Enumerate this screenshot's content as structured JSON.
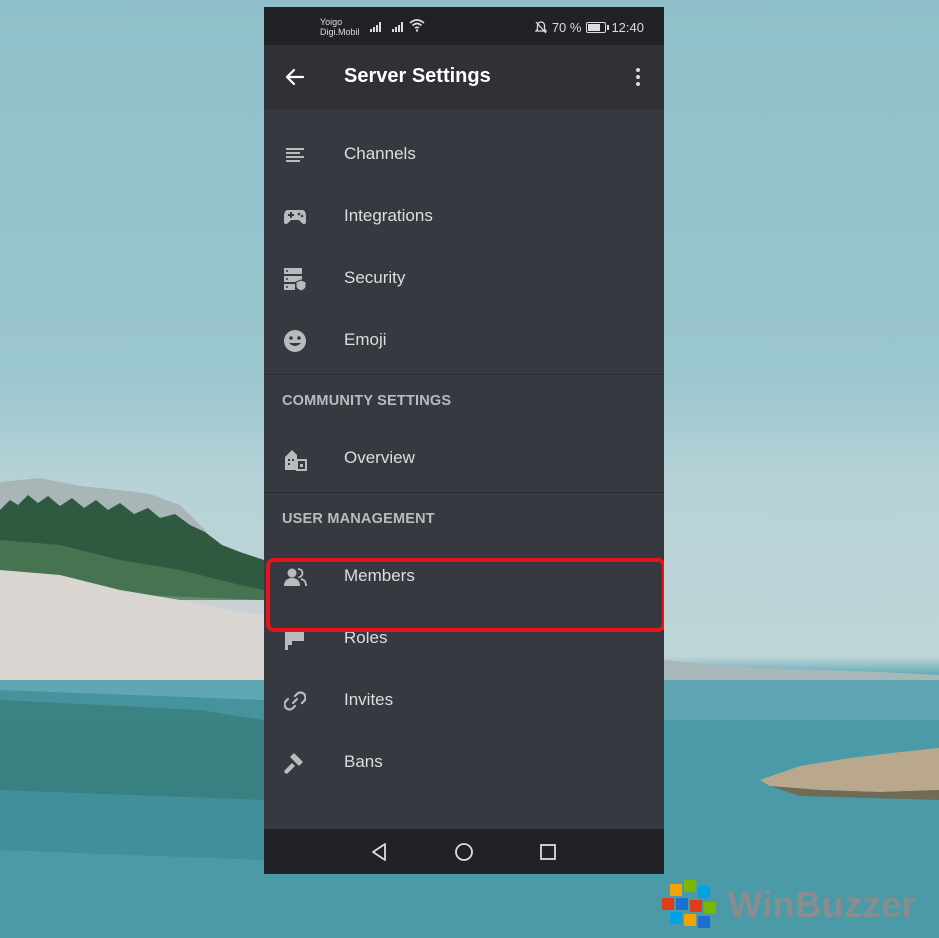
{
  "status_bar": {
    "carrier_1": "Yoigo",
    "carrier_2": "Digi.Mobil",
    "battery": "70 %",
    "battery_level": 0.7,
    "time": "12:40"
  },
  "app_bar": {
    "title": "Server Settings",
    "back_icon": "arrow-left-icon",
    "more_icon": "more-vertical-icon"
  },
  "menu": {
    "main_items": [
      {
        "label": "Channels",
        "icon": "list-icon"
      },
      {
        "label": "Integrations",
        "icon": "gamepad-icon"
      },
      {
        "label": "Security",
        "icon": "server-shield-icon"
      },
      {
        "label": "Emoji",
        "icon": "smile-icon"
      }
    ],
    "community_header": "COMMUNITY SETTINGS",
    "community_items": [
      {
        "label": "Overview",
        "icon": "community-icon"
      }
    ],
    "user_header": "USER MANAGEMENT",
    "user_items": [
      {
        "label": "Members",
        "icon": "people-icon"
      },
      {
        "label": "Roles",
        "icon": "flag-icon"
      },
      {
        "label": "Invites",
        "icon": "link-icon"
      },
      {
        "label": "Bans",
        "icon": "hammer-icon"
      }
    ]
  },
  "nav_bar": {
    "back": "triangle-back-icon",
    "home": "circle-home-icon",
    "recents": "square-recents-icon"
  },
  "watermark": {
    "text": "WinBuzzer"
  },
  "colors": {
    "phone_bg": "#36393f",
    "app_bar_bg": "#2f3136",
    "status_bar_bg": "#202225",
    "highlight": "#e8131b",
    "text": "#dcddde",
    "header_text": "#b9bbbe"
  }
}
